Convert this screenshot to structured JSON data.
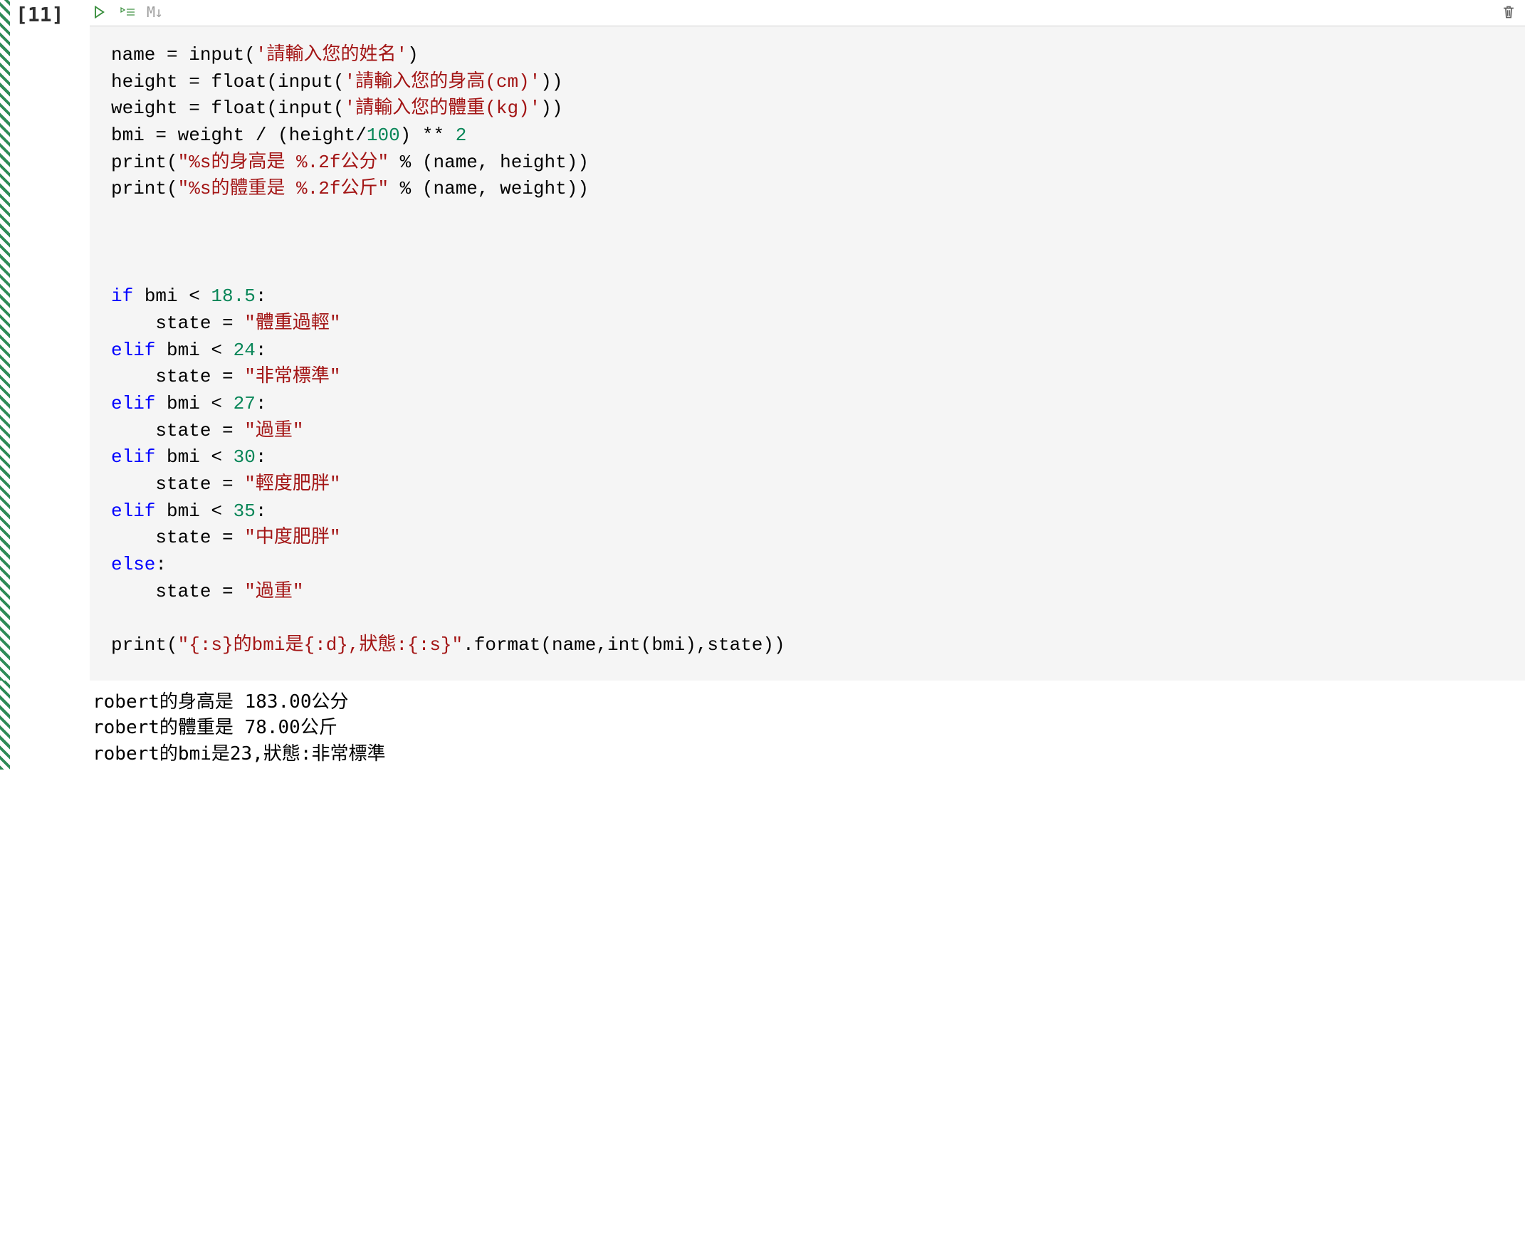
{
  "cell": {
    "execution_count": "[11]",
    "toolbar": {
      "markdown_label": "M↓"
    },
    "code_tokens": [
      [
        [
          "name = input(",
          "b"
        ],
        [
          "'請輸入您的姓名'",
          "s"
        ],
        [
          ")",
          "b"
        ]
      ],
      [
        [
          "height = float(input(",
          "b"
        ],
        [
          "'請輸入您的身高(cm)'",
          "s"
        ],
        [
          "))",
          "b"
        ]
      ],
      [
        [
          "weight = float(input(",
          "b"
        ],
        [
          "'請輸入您的體重(kg)'",
          "s"
        ],
        [
          "))",
          "b"
        ]
      ],
      [
        [
          "bmi = weight / (height/",
          "b"
        ],
        [
          "100",
          "n"
        ],
        [
          ") ** ",
          "b"
        ],
        [
          "2",
          "n"
        ]
      ],
      [
        [
          "print(",
          "b"
        ],
        [
          "\"%s",
          "s"
        ],
        [
          "的身高是 ",
          "s"
        ],
        [
          "%.2f",
          "s"
        ],
        [
          "公分\"",
          "s"
        ],
        [
          " % (name, height))",
          "b"
        ]
      ],
      [
        [
          "print(",
          "b"
        ],
        [
          "\"%s",
          "s"
        ],
        [
          "的體重是 ",
          "s"
        ],
        [
          "%.2f",
          "s"
        ],
        [
          "公斤\"",
          "s"
        ],
        [
          " % (name, weight))",
          "b"
        ]
      ],
      [
        [
          "",
          "b"
        ]
      ],
      [
        [
          "",
          "b"
        ]
      ],
      [
        [
          "",
          "b"
        ]
      ],
      [
        [
          "if",
          "k"
        ],
        [
          " bmi < ",
          "b"
        ],
        [
          "18.5",
          "n"
        ],
        [
          ":",
          "b"
        ]
      ],
      [
        [
          "    state = ",
          "b"
        ],
        [
          "\"體重過輕\"",
          "s"
        ]
      ],
      [
        [
          "elif",
          "k"
        ],
        [
          " bmi < ",
          "b"
        ],
        [
          "24",
          "n"
        ],
        [
          ":",
          "b"
        ]
      ],
      [
        [
          "    state = ",
          "b"
        ],
        [
          "\"非常標準\"",
          "s"
        ]
      ],
      [
        [
          "elif",
          "k"
        ],
        [
          " bmi < ",
          "b"
        ],
        [
          "27",
          "n"
        ],
        [
          ":",
          "b"
        ]
      ],
      [
        [
          "    state = ",
          "b"
        ],
        [
          "\"過重\"",
          "s"
        ]
      ],
      [
        [
          "elif",
          "k"
        ],
        [
          " bmi < ",
          "b"
        ],
        [
          "30",
          "n"
        ],
        [
          ":",
          "b"
        ]
      ],
      [
        [
          "    state = ",
          "b"
        ],
        [
          "\"輕度肥胖\"",
          "s"
        ]
      ],
      [
        [
          "elif",
          "k"
        ],
        [
          " bmi < ",
          "b"
        ],
        [
          "35",
          "n"
        ],
        [
          ":",
          "b"
        ]
      ],
      [
        [
          "    state = ",
          "b"
        ],
        [
          "\"中度肥胖\"",
          "s"
        ]
      ],
      [
        [
          "else",
          "k"
        ],
        [
          ":",
          "b"
        ]
      ],
      [
        [
          "    state = ",
          "b"
        ],
        [
          "\"過重\"",
          "s"
        ]
      ],
      [
        [
          "",
          "b"
        ]
      ],
      [
        [
          "print(",
          "b"
        ],
        [
          "\"{:s}",
          "s"
        ],
        [
          "的",
          "s"
        ],
        [
          "bmi",
          "s"
        ],
        [
          "是",
          "s"
        ],
        [
          "{:d}",
          "s"
        ],
        [
          ",",
          "s"
        ],
        [
          "狀態:",
          "s"
        ],
        [
          "{:s}\"",
          "s"
        ],
        [
          ".format(name,int(bmi),state))",
          "b"
        ]
      ]
    ],
    "output_lines": [
      "robert的身高是 183.00公分",
      "robert的體重是 78.00公斤",
      "robert的bmi是23,狀態:非常標準"
    ]
  }
}
